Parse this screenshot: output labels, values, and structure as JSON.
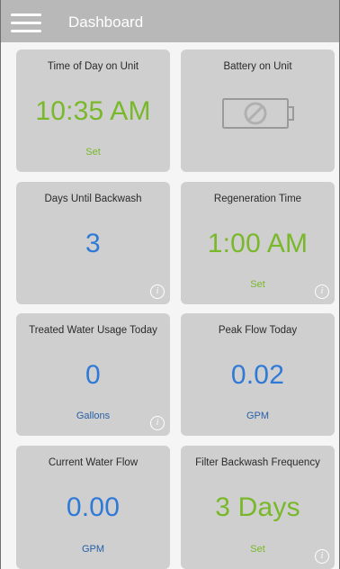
{
  "header": {
    "title": "Dashboard",
    "menu_icon": "hamburger-menu-icon"
  },
  "cards": [
    {
      "title": "Time of Day on Unit",
      "value": "10:35 AM",
      "sub": "Set",
      "value_color": "#79b82a",
      "sub_color": "#79b82a"
    },
    {
      "title": "Battery on Unit",
      "icon": "battery-disabled-icon"
    },
    {
      "title": "Days Until Backwash",
      "value": "3",
      "value_color": "#2f7ad7",
      "info_icon": "info-icon"
    },
    {
      "title": "Regeneration Time",
      "value": "1:00 AM",
      "sub": "Set",
      "value_color": "#79b82a",
      "sub_color": "#79b82a",
      "info_icon": "info-icon"
    },
    {
      "title": "Treated Water Usage Today",
      "value": "0",
      "sub": "Gallons",
      "value_color": "#2f7ad7",
      "sub_color": "#2860a8",
      "info_icon": "info-icon"
    },
    {
      "title": "Peak Flow Today",
      "value": "0.02",
      "sub": "GPM",
      "value_color": "#2f7ad7",
      "sub_color": "#2860a8"
    },
    {
      "title": "Current Water Flow",
      "value": "0.00",
      "sub": "GPM",
      "value_color": "#2f7ad7",
      "sub_color": "#2860a8"
    },
    {
      "title": "Filter Backwash Frequency",
      "value": "3 Days",
      "sub": "Set",
      "value_color": "#79b82a",
      "sub_color": "#79b82a",
      "info_icon": "info-icon"
    }
  ]
}
